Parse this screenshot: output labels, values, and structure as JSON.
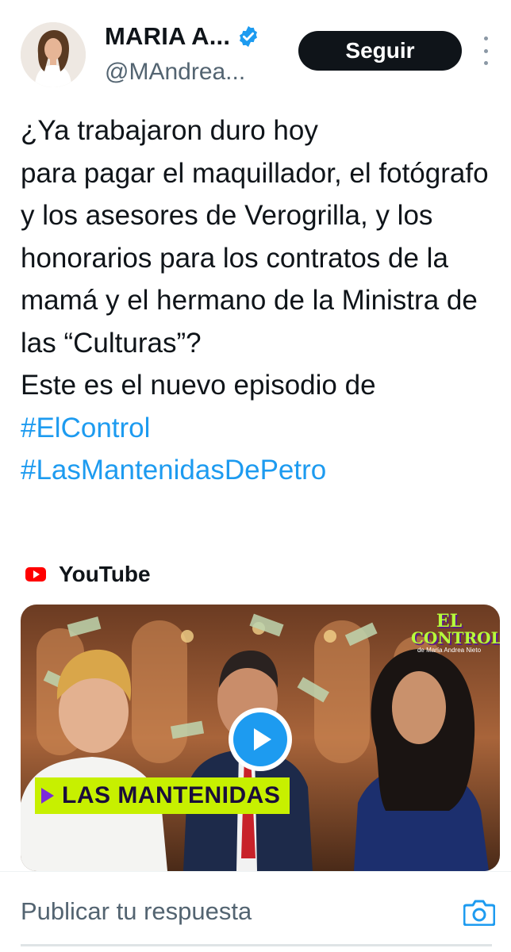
{
  "header": {
    "display_name": "MARIA A...",
    "handle": "@MAndrea...",
    "follow_label": "Seguir",
    "verified": true,
    "avatar_icon": "profile-photo"
  },
  "tweet": {
    "body": "¿Ya trabajaron duro hoy\npara pagar el maquillador, el fotógrafo y los asesores de Verogrilla, y los honorarios para los contratos de la mamá y el hermano de la Ministra de las “Culturas”?\nEste es el nuevo episodio de",
    "hashtags": [
      "#ElControl",
      "#LasMantenidasDePetro"
    ]
  },
  "card": {
    "source_label": "YouTube",
    "banner_text": "LAS MANTENIDAS",
    "logo_line1": "EL",
    "logo_line2": "CONTROL",
    "logo_sub": "de María Andrea Nieto"
  },
  "reply": {
    "placeholder": "Publicar tu respuesta"
  },
  "colors": {
    "accent": "#1d9bf0",
    "text": "#0f1419",
    "secondary": "#536471",
    "banner": "#c7f000",
    "youtube_red": "#ff0000"
  }
}
